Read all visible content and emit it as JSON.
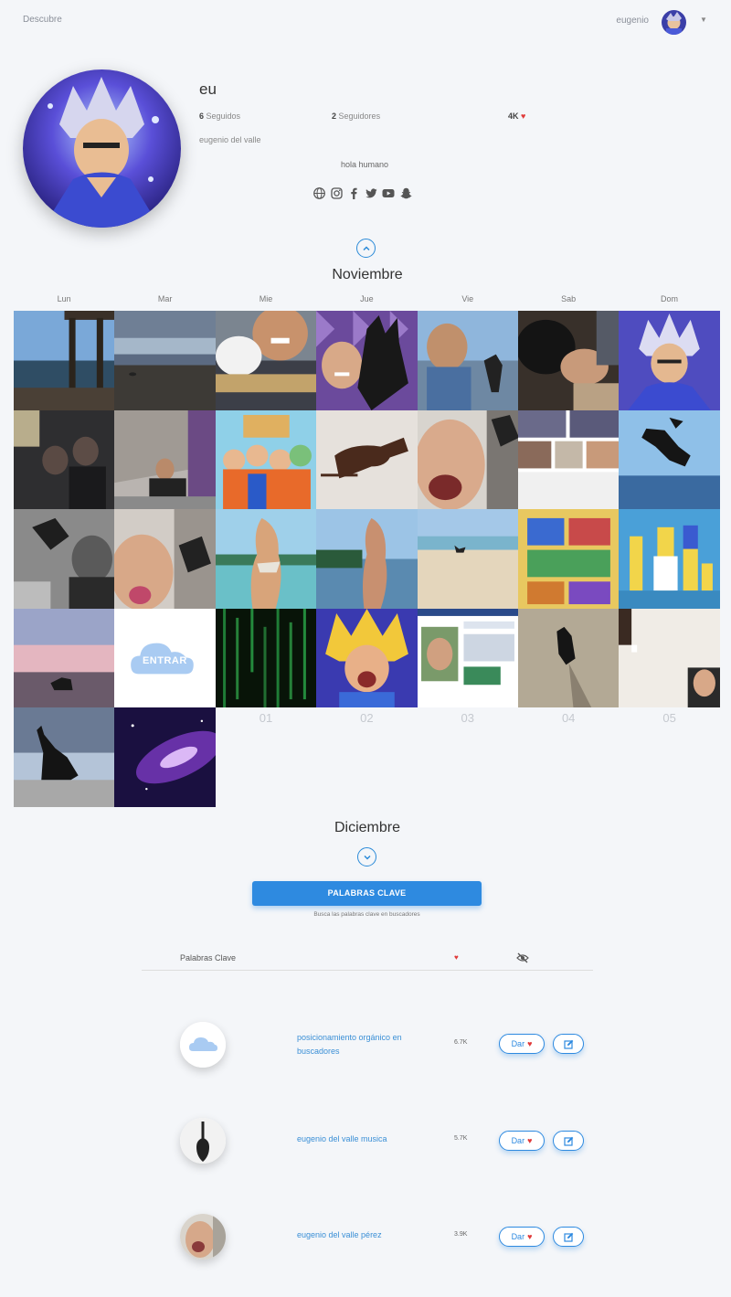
{
  "nav": {
    "discover": "Descubre",
    "username": "eugenio"
  },
  "profile": {
    "handle": "eu",
    "following_count": "6",
    "following_label": "Seguidos",
    "followers_count": "2",
    "followers_label": "Seguidores",
    "likes": "4K",
    "full_name": "eugenio del valle",
    "bio": "hola humano",
    "socials": [
      "globe-icon",
      "instagram-icon",
      "facebook-icon",
      "twitter-icon",
      "youtube-icon",
      "snapchat-icon"
    ]
  },
  "calendar": {
    "current_month": "Noviembre",
    "next_month": "Diciembre",
    "weekdays": [
      "Lun",
      "Mar",
      "Mie",
      "Jue",
      "Vie",
      "Sab",
      "Dom"
    ],
    "empty_days": [
      "01",
      "02",
      "03",
      "04",
      "05"
    ],
    "enter_label": "ENTRAR",
    "photos": [
      "pier-sunset",
      "beach-dusk",
      "selfie-guitar",
      "selfie-dog-purple",
      "beach-selfie",
      "dog-sleeping",
      "goku-avatar",
      "dark-room",
      "man-sitting-wall",
      "dragonball-group",
      "dog-on-bed",
      "open-mouth-selfie",
      "photo-collage",
      "dog-jumping-sea",
      "bw-selfie-dog",
      "selfie-tongue",
      "beach-woman",
      "lake-woman",
      "sandy-beach-dog",
      "colorful-cartoon",
      "simpsons-family",
      "dog-pink-sunset",
      "enter-cloud",
      "matrix-code",
      "super-saiyan",
      "screenshot-page",
      "dog-in-water",
      "video-call",
      "dog-silhouette",
      "purple-galaxy"
    ]
  },
  "keywords": {
    "button_label": "PALABRAS CLAVE",
    "hint": "Busca las palabras clave en buscadores",
    "column_label": "Palabras Clave",
    "give_label": "Dar",
    "rows": [
      {
        "keyword": "posicionamiento orgánico en buscadores",
        "count": "6.7K"
      },
      {
        "keyword": "eugenio del valle musica",
        "count": "5.7K"
      },
      {
        "keyword": "eugenio del valle pérez",
        "count": "3.9K"
      }
    ]
  },
  "colors": {
    "accent": "#2e8ae0",
    "heart": "#e03a3a"
  }
}
